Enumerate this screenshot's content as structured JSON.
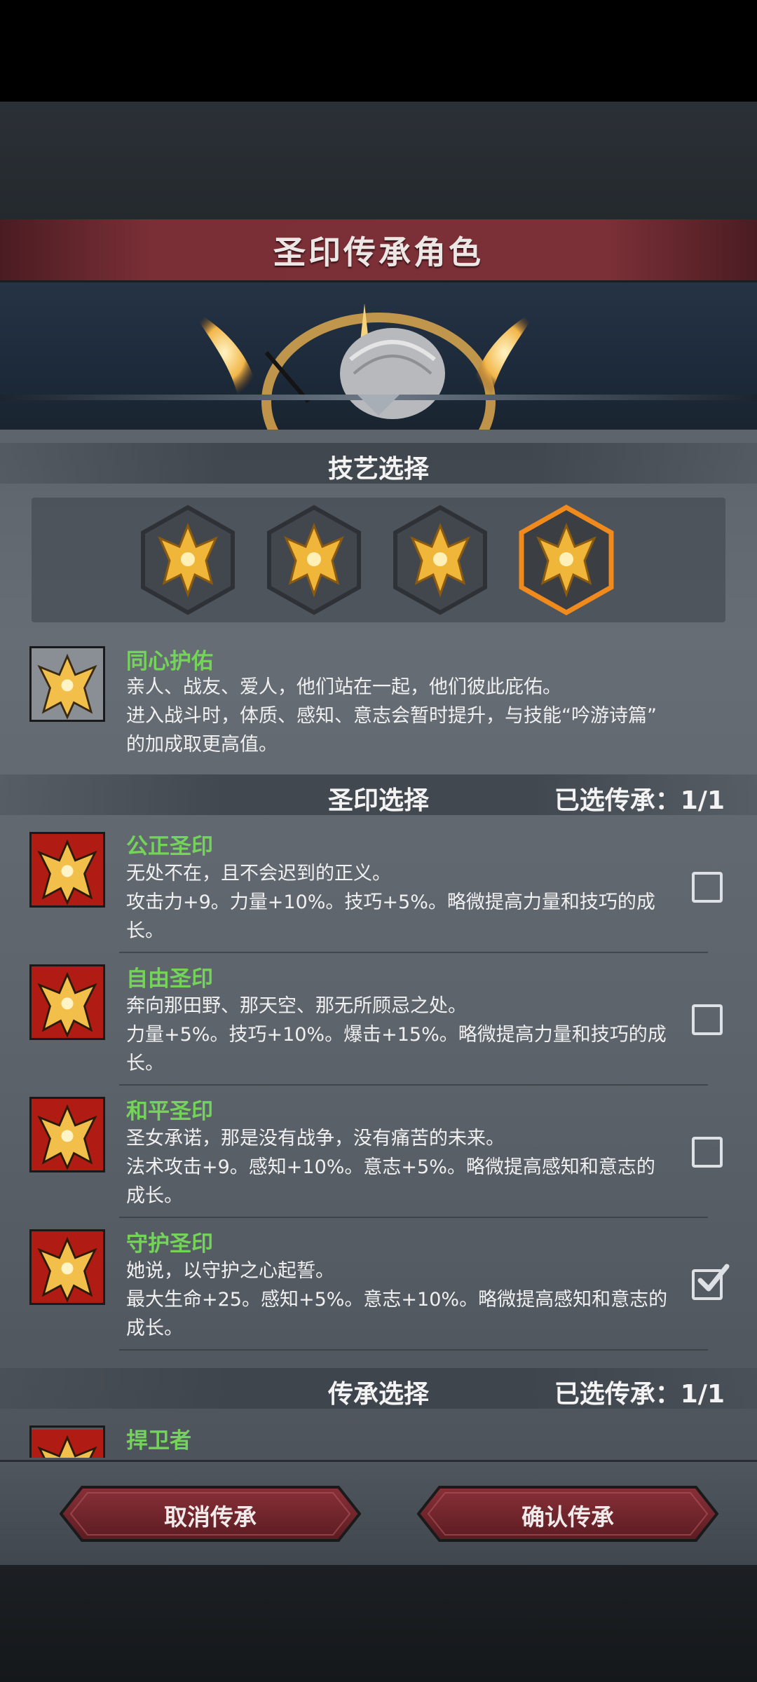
{
  "header": {
    "title": "圣印传承角色"
  },
  "skill_section": {
    "heading": "技艺选择",
    "options": [
      {
        "icon": "golden-crest-icon",
        "selected": false
      },
      {
        "icon": "golden-crest-icon",
        "selected": false
      },
      {
        "icon": "golden-crest-icon",
        "selected": false
      },
      {
        "icon": "golden-crest-icon",
        "selected": true
      }
    ],
    "selected_skill": {
      "name": "同心护佑",
      "line1": "亲人、战友、爱人，他们站在一起，他们彼此庇佑。",
      "line2": "进入战斗时，体质、感知、意志会暂时提升，与技能“吟游诗篇”",
      "line3": "的加成取更高值。"
    }
  },
  "seal_section": {
    "heading": "圣印选择",
    "count": "已选传承：1/1",
    "items": [
      {
        "name": "公正圣印",
        "line1": "无处不在，且不会迟到的正义。",
        "line2": "攻击力+9。力量+10%。技巧+5%。略微提高力量和技巧的成",
        "line3": "长。",
        "checked": false
      },
      {
        "name": "自由圣印",
        "line1": "奔向那田野、那天空、那无所顾忌之处。",
        "line2": "力量+5%。技巧+10%。爆击+15%。略微提高力量和技巧的成",
        "line3": "长。",
        "checked": false
      },
      {
        "name": "和平圣印",
        "line1": "圣女承诺，那是没有战争，没有痛苦的未来。",
        "line2": "法术攻击+9。感知+10%。意志+5%。略微提高感知和意志的",
        "line3": "成长。",
        "checked": false
      },
      {
        "name": "守护圣印",
        "line1": "她说，以守护之心起誓。",
        "line2": "最大生命+25。感知+5%。意志+10%。略微提高感知和意志的",
        "line3": "成长。",
        "checked": true
      }
    ]
  },
  "inherit_section": {
    "heading": "传承选择",
    "count": "已选传承：1/1",
    "first_item": "捍卫者"
  },
  "buttons": {
    "cancel": "取消传承",
    "confirm": "确认传承"
  },
  "colors": {
    "accent_orange": "#f08a1c",
    "title_green": "#74d45a",
    "banner_red": "#7a2f36"
  }
}
